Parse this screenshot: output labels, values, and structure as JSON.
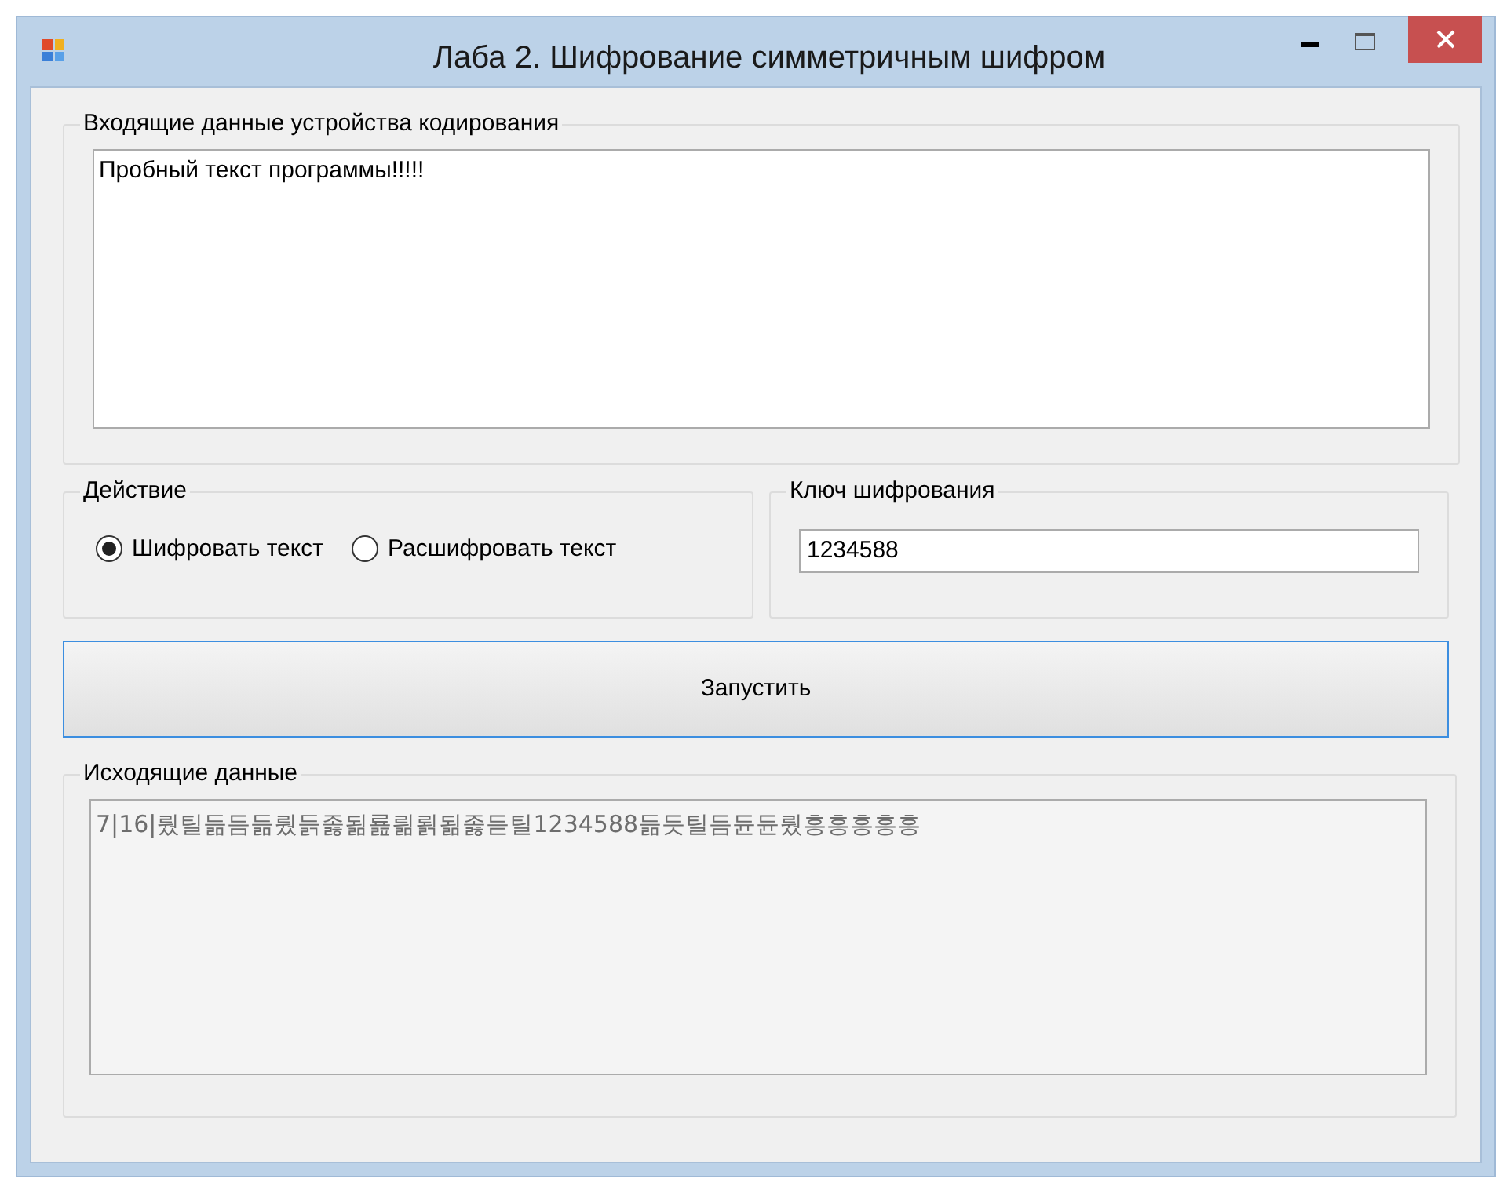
{
  "window": {
    "title": "Лаба 2. Шифрование симметричным шифром"
  },
  "input_group": {
    "title": "Входящие данные устройства кодирования",
    "value": "Пробный текст программы!!!!!"
  },
  "action_group": {
    "title": "Действие",
    "options": [
      {
        "label": "Шифровать текст",
        "selected": true
      },
      {
        "label": "Расшифровать текст",
        "selected": false
      }
    ]
  },
  "key_group": {
    "title": "Ключ шифрования",
    "value": "1234588"
  },
  "run_button": {
    "label": "Запустить"
  },
  "output_group": {
    "title": "Исходящие данные",
    "value": "7|16|뤘틸듦듬듦뤘듥졿됢룚릚뢹됢졿듣틸1234588듦듯틸듬듄듄뤘흥흥흥흥흥"
  }
}
